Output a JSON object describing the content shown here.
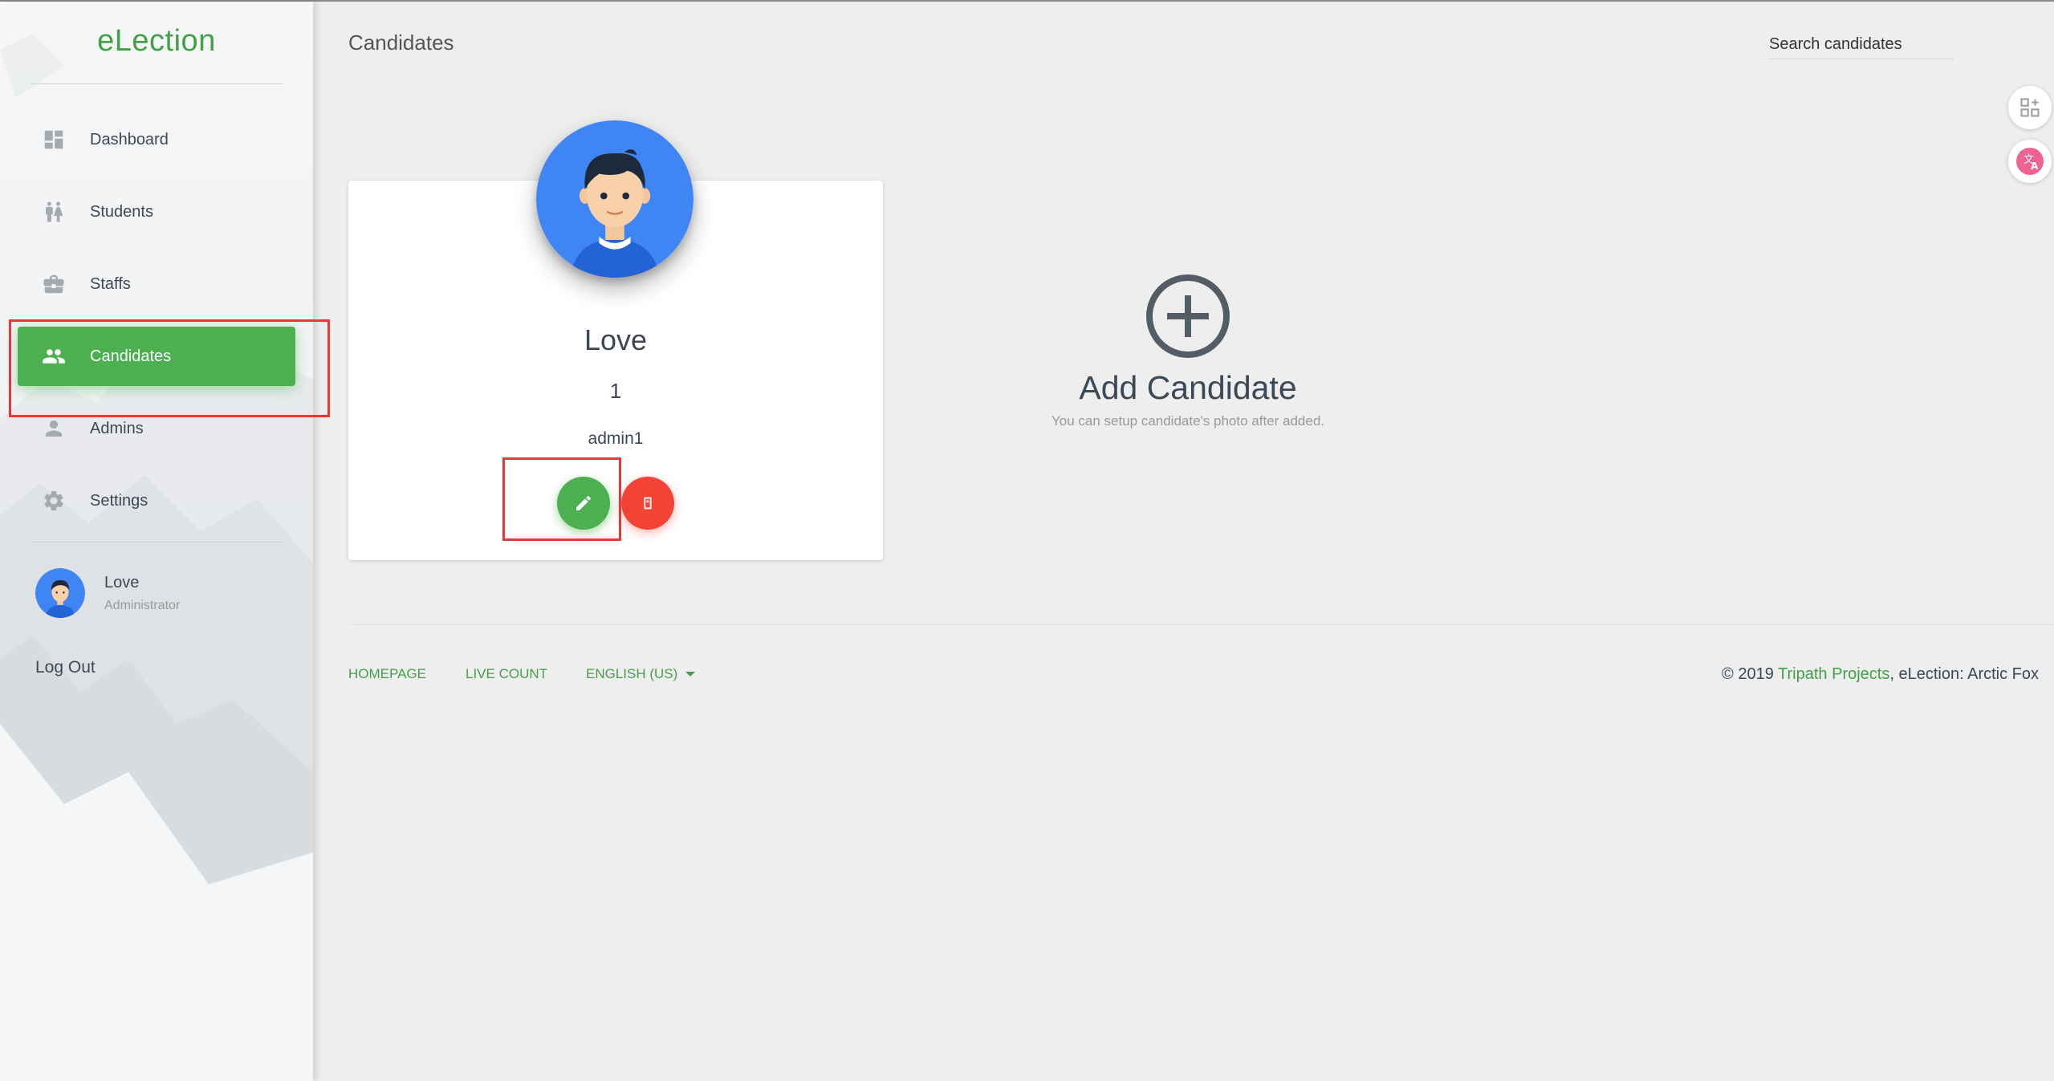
{
  "app": {
    "brand": "eLection",
    "page_title": "Candidates"
  },
  "sidebar": {
    "items": [
      {
        "label": "Dashboard",
        "icon": "dashboard-icon"
      },
      {
        "label": "Students",
        "icon": "students-icon"
      },
      {
        "label": "Staffs",
        "icon": "briefcase-icon"
      },
      {
        "label": "Candidates",
        "icon": "people-icon",
        "active": true
      },
      {
        "label": "Admins",
        "icon": "person-icon"
      },
      {
        "label": "Settings",
        "icon": "gear-icon"
      }
    ],
    "user": {
      "name": "Love",
      "role": "Administrator"
    },
    "logout_label": "Log Out"
  },
  "search": {
    "placeholder": "Search candidates"
  },
  "candidates": [
    {
      "name": "Love",
      "number": "1",
      "position": "admin1"
    }
  ],
  "add_candidate": {
    "title": "Add Candidate",
    "subtitle": "You can setup candidate's photo after added."
  },
  "footer": {
    "links": [
      "HOMEPAGE",
      "LIVE COUNT",
      "ENGLISH (US)"
    ],
    "copyright_prefix": "© 2019",
    "copyright_link": "Tripath Projects",
    "copyright_suffix": ", eLection: Arctic Fox"
  },
  "colors": {
    "accent_green": "#4caf50",
    "brand_green": "#43a047",
    "danger_red": "#f44336",
    "avatar_blue": "#3f85f4",
    "highlight_red": "#e53935"
  }
}
